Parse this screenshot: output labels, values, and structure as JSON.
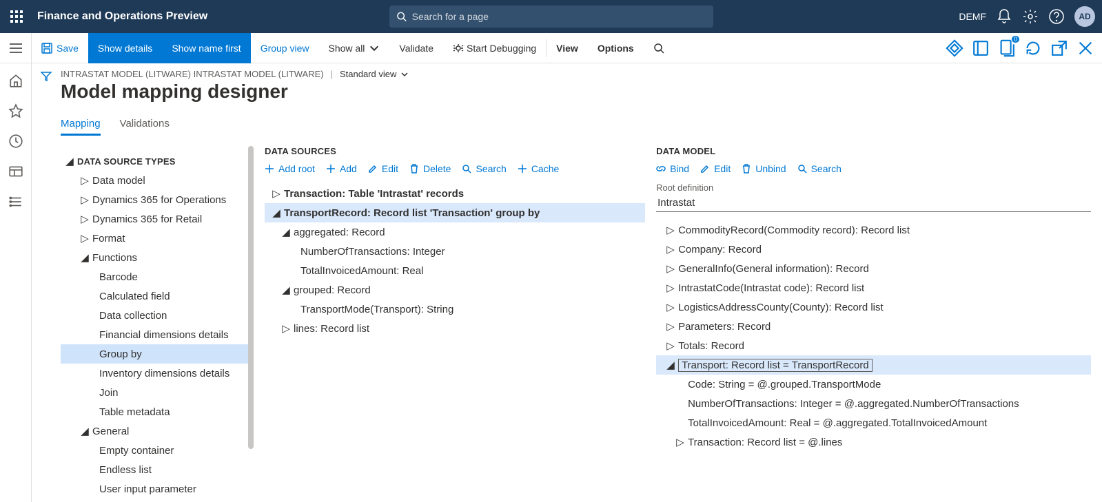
{
  "topbar": {
    "app_title": "Finance and Operations Preview",
    "search_placeholder": "Search for a page",
    "tenant": "DEMF",
    "avatar": "AD"
  },
  "actionbar": {
    "save": "Save",
    "show_details": "Show details",
    "show_name_first": "Show name first",
    "group_view": "Group view",
    "show_all": "Show all",
    "validate": "Validate",
    "start_debugging": "Start Debugging",
    "view": "View",
    "options": "Options",
    "doc_badge": "0"
  },
  "breadcrumb": {
    "path": "INTRASTAT MODEL (LITWARE) INTRASTAT MODEL (LITWARE)",
    "view": "Standard view"
  },
  "page_title": "Model mapping designer",
  "tabs": {
    "mapping": "Mapping",
    "validations": "Validations"
  },
  "col1": {
    "header": "DATA SOURCE TYPES",
    "items": {
      "data_model": "Data model",
      "d365_ops": "Dynamics 365 for Operations",
      "d365_retail": "Dynamics 365 for Retail",
      "format": "Format",
      "functions": "Functions",
      "barcode": "Barcode",
      "calc_field": "Calculated field",
      "data_collection": "Data collection",
      "fin_dim": "Financial dimensions details",
      "group_by": "Group by",
      "inv_dim": "Inventory dimensions details",
      "join": "Join",
      "table_meta": "Table metadata",
      "general": "General",
      "empty_cont": "Empty container",
      "endless_list": "Endless list",
      "user_input": "User input parameter"
    }
  },
  "col2": {
    "header": "DATA SOURCES",
    "toolbar": {
      "add_root": "Add root",
      "add": "Add",
      "edit": "Edit",
      "delete": "Delete",
      "search": "Search",
      "cache": "Cache"
    },
    "items": {
      "transaction": "Transaction: Table 'Intrastat' records",
      "transport_record": "TransportRecord: Record list 'Transaction' group by",
      "aggregated": "aggregated: Record",
      "num_trans": "NumberOfTransactions: Integer",
      "total_inv": "TotalInvoicedAmount: Real",
      "grouped": "grouped: Record",
      "transport_mode": "TransportMode(Transport): String",
      "lines": "lines: Record list"
    }
  },
  "col3": {
    "header": "DATA MODEL",
    "toolbar": {
      "bind": "Bind",
      "edit": "Edit",
      "unbind": "Unbind",
      "search": "Search"
    },
    "root_def_label": "Root definition",
    "root_def_value": "Intrastat",
    "items": {
      "commodity": "CommodityRecord(Commodity record): Record list",
      "company": "Company: Record",
      "general_info": "GeneralInfo(General information): Record",
      "intrastat_code": "IntrastatCode(Intrastat code): Record list",
      "logistics": "LogisticsAddressCounty(County): Record list",
      "parameters": "Parameters: Record",
      "totals": "Totals: Record",
      "transport": "Transport: Record list = TransportRecord",
      "code": "Code: String = @.grouped.TransportMode",
      "num_trans": "NumberOfTransactions: Integer = @.aggregated.NumberOfTransactions",
      "total_inv": "TotalInvoicedAmount: Real = @.aggregated.TotalInvoicedAmount",
      "transaction": "Transaction: Record list = @.lines"
    }
  }
}
